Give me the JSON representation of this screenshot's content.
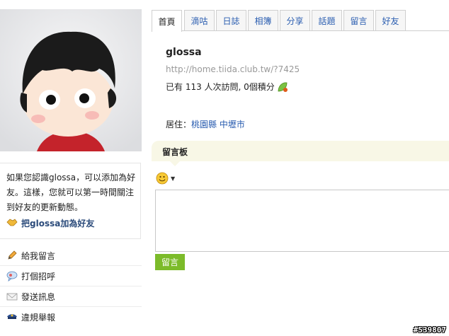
{
  "tabs": [
    {
      "label": "首頁",
      "active": true
    },
    {
      "label": "滴咕",
      "active": false
    },
    {
      "label": "日誌",
      "active": false
    },
    {
      "label": "相簿",
      "active": false
    },
    {
      "label": "分享",
      "active": false
    },
    {
      "label": "話題",
      "active": false
    },
    {
      "label": "留言",
      "active": false
    },
    {
      "label": "好友",
      "active": false
    }
  ],
  "profile": {
    "username": "glossa",
    "home_url": "http://home.tiida.club.tw/?7425",
    "visits": "已有 113 人次訪問, 0個積分",
    "residence_label": "居住：",
    "residence_county": "桃園縣",
    "residence_city": "中壢市"
  },
  "intro": {
    "text": "如果您認識glossa，可以添加為好友。這樣，您就可以第一時間關注到好友的更新動態。",
    "add_friend": "把glossa加為好友"
  },
  "actions": [
    {
      "label": "給我留言",
      "icon": "pencil-icon"
    },
    {
      "label": "打個招呼",
      "icon": "chat-bubble-icon"
    },
    {
      "label": "發送訊息",
      "icon": "envelope-icon"
    },
    {
      "label": "違規舉報",
      "icon": "police-cap-icon"
    }
  ],
  "board": {
    "title": "留言板",
    "submit_label": "留言",
    "message_value": ""
  },
  "watermark": "#539807",
  "colors": {
    "accent_green": "#7cbb2a",
    "link_blue": "#2a5db0",
    "board_bg": "#f8f7e6"
  }
}
